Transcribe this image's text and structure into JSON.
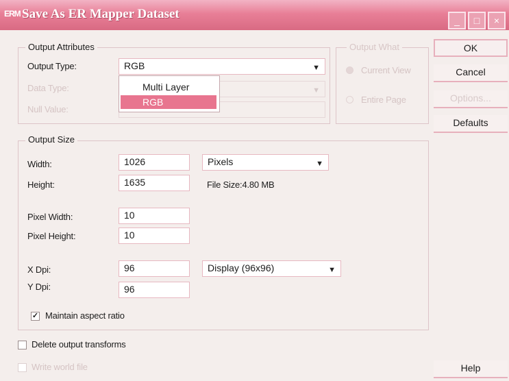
{
  "window": {
    "app_icon": "ERM",
    "title": "Save As ER Mapper Dataset",
    "controls": {
      "minimize": "_",
      "maximize": "□",
      "close": "×"
    }
  },
  "output_attributes": {
    "group_label": "Output Attributes",
    "output_type_label": "Output Type:",
    "output_type_value": "RGB",
    "output_type_options": [
      "Multi Layer",
      "RGB"
    ],
    "data_type_label": "Data Type:",
    "null_value_label": "Null Value:"
  },
  "output_what": {
    "group_label": "Output What",
    "current_view_label": "Current View",
    "entire_page_label": "Entire Page"
  },
  "output_size": {
    "group_label": "Output Size",
    "width_label": "Width:",
    "width_value": "1026",
    "height_label": "Height:",
    "height_value": "1635",
    "units_value": "Pixels",
    "file_size_text": "File Size:4.80 MB",
    "pixel_width_label": "Pixel Width:",
    "pixel_width_value": "10",
    "pixel_height_label": "Pixel Height:",
    "pixel_height_value": "10",
    "x_dpi_label": "X Dpi:",
    "x_dpi_value": "96",
    "y_dpi_label": "Y Dpi:",
    "y_dpi_value": "96",
    "display_value": "Display (96x96)",
    "maintain_aspect_label": "Maintain aspect ratio",
    "maintain_aspect_checked": true
  },
  "options": {
    "delete_transforms_label": "Delete output transforms",
    "delete_transforms_checked": false,
    "write_world_label": "Write world file",
    "write_world_checked": false
  },
  "buttons": {
    "ok": "OK",
    "cancel": "Cancel",
    "options": "Options...",
    "defaults": "Defaults",
    "help": "Help"
  },
  "colors": {
    "title_bar": "#e87f97",
    "selection": "#e8758f",
    "background": "#f4eeec"
  }
}
